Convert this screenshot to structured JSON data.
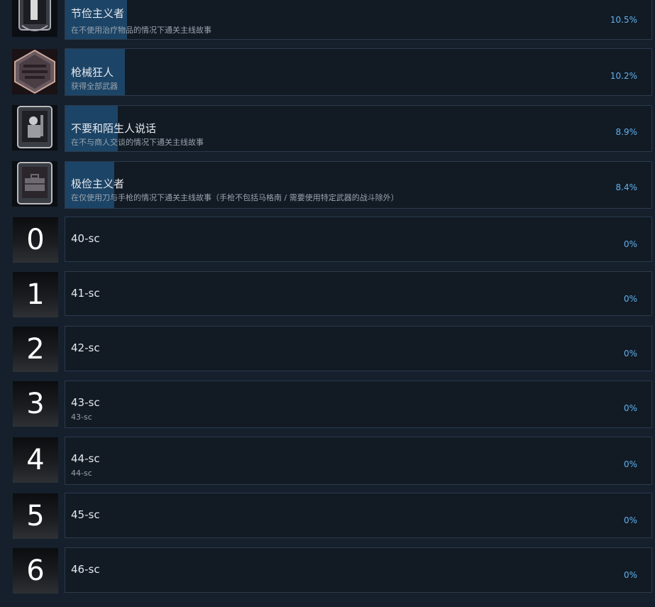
{
  "achievements": [
    {
      "title": "节俭主义者",
      "desc": "在不使用治疗物品的情况下通关主线故事",
      "pct": "10.5%",
      "progress": 0.105,
      "icon": "medal-frame-icon"
    },
    {
      "title": "枪械狂人",
      "desc": "获得全部武器",
      "pct": "10.2%",
      "progress": 0.102,
      "icon": "guns-hexagon-icon"
    },
    {
      "title": "不要和陌生人说话",
      "desc": "在不与商人交谈的情况下通关主线故事",
      "pct": "8.9%",
      "progress": 0.089,
      "icon": "merchant-frame-icon"
    },
    {
      "title": "极俭主义者",
      "desc": "在仅使用刀与手枪的情况下通关主线故事（手枪不包括马格南 / 需要使用特定武器的战斗除外）",
      "pct": "8.4%",
      "progress": 0.084,
      "icon": "briefcase-frame-icon"
    }
  ],
  "hidden": [
    {
      "num": "0",
      "title": "40-sc",
      "desc": "",
      "pct": "0%"
    },
    {
      "num": "1",
      "title": "41-sc",
      "desc": "",
      "pct": "0%"
    },
    {
      "num": "2",
      "title": "42-sc",
      "desc": "",
      "pct": "0%"
    },
    {
      "num": "3",
      "title": "43-sc",
      "desc": "43-sc",
      "pct": "0%"
    },
    {
      "num": "4",
      "title": "44-sc",
      "desc": "44-sc",
      "pct": "0%"
    },
    {
      "num": "5",
      "title": "45-sc",
      "desc": "",
      "pct": "0%"
    },
    {
      "num": "6",
      "title": "46-sc",
      "desc": "",
      "pct": "0%"
    }
  ],
  "colors": {
    "background": "#16202d",
    "card": "#121a24",
    "progress": "#1c4466",
    "percent": "#5fb2ef"
  }
}
